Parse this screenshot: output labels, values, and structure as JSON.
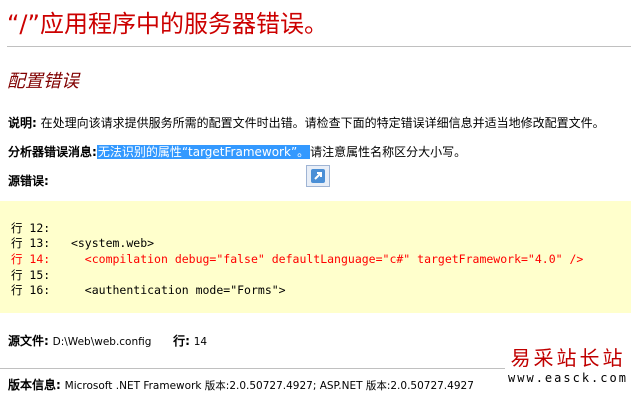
{
  "page": {
    "title": "“/”应用程序中的服务器错误。",
    "subtitle": "配置错误"
  },
  "description": {
    "label": "说明:",
    "text": "在处理向该请求提供服务所需的配置文件时出错。请检查下面的特定错误详细信息并适当地修改配置文件。"
  },
  "parser_error": {
    "label": "分析器错误消息:",
    "selected_text": "无法识别的属性“targetFramework”。",
    "rest_text": "请注意属性名称区分大小写。"
  },
  "source_error": {
    "label": "源错误:",
    "lines": [
      {
        "text": "行 12:",
        "highlight": false
      },
      {
        "text": "行 13:   <system.web>",
        "highlight": false
      },
      {
        "text": "行 14:     <compilation debug=\"false\" defaultLanguage=\"c#\" targetFramework=\"4.0\" />",
        "highlight": true
      },
      {
        "text": "行 15:",
        "highlight": false
      },
      {
        "text": "行 16:     <authentication mode=\"Forms\">",
        "highlight": false
      }
    ]
  },
  "source_file": {
    "label": "源文件:",
    "value": "D:\\Web\\web.config",
    "line_label": "行:",
    "line_value": "14"
  },
  "version": {
    "label": "版本信息:",
    "value": "Microsoft .NET Framework 版本:2.0.50727.4927; ASP.NET 版本:2.0.50727.4927"
  },
  "watermark": {
    "name": "易采站长站",
    "url": "www.easck.com"
  },
  "colors": {
    "title": "#cc0000",
    "subtitle": "#800000",
    "selection": "#3399ff",
    "code_background": "#ffffcc",
    "code_highlight": "#ff0000"
  },
  "icons": {
    "selection_action": "arrow-up-right-icon"
  }
}
